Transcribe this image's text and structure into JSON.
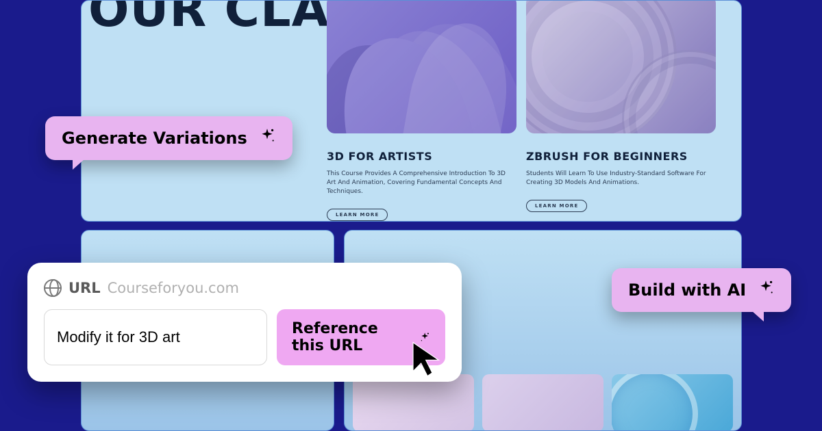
{
  "hero": {
    "title": "OUR CLASSES"
  },
  "courses": [
    {
      "title": "3D FOR ARTISTS",
      "desc": "This Course Provides A Comprehensive Introduction To 3D Art And Animation, Covering Fundamental Concepts And Techniques.",
      "cta": "LEARN MORE"
    },
    {
      "title": "ZBRUSH FOR BEGINNERS",
      "desc": "Students Will Learn To Use Industry-Standard Software For Creating 3D Models And Animations.",
      "cta": "LEARN MORE"
    }
  ],
  "floaters": {
    "generate": "Generate Variations",
    "build": "Build with AI"
  },
  "popup": {
    "url_label": "URL",
    "domain": "Courseforyou.com",
    "input_value": "Modify it for 3D art",
    "ref_btn": "Reference this URL"
  },
  "colors": {
    "accent_pill": "#e8b4f0",
    "bg": "#1a1b8c",
    "panel": "#bfe0f4"
  }
}
